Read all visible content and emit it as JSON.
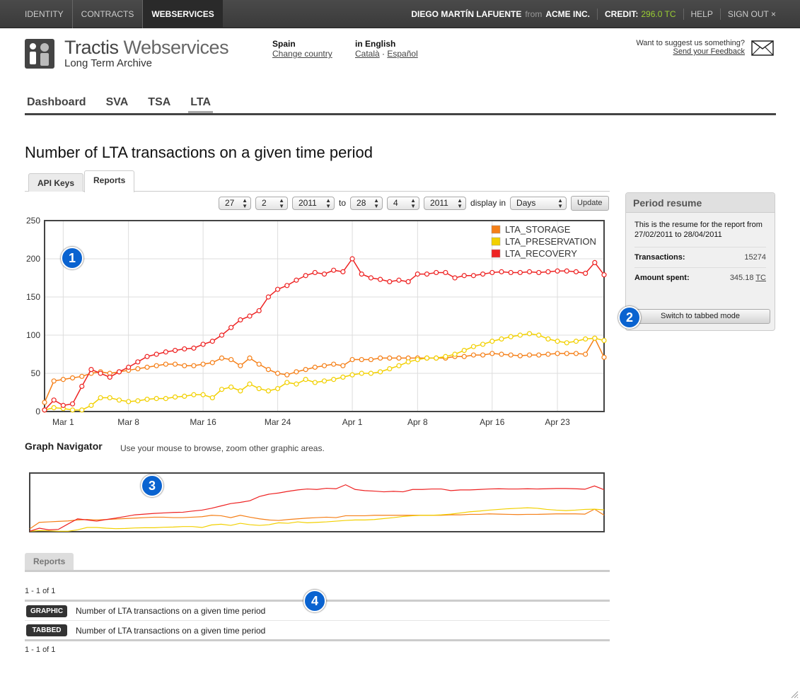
{
  "topbar": {
    "nav": [
      "IDENTITY",
      "CONTRACTS",
      "WEBSERVICES"
    ],
    "active_nav": "WEBSERVICES",
    "user": "DIEGO MARTÍN LAFUENTE",
    "from": "from",
    "company": "ACME INC.",
    "credit_label": "CREDIT:",
    "credit_value": "296.0 TC",
    "help": "HELP",
    "signout": "SIGN OUT ×"
  },
  "header": {
    "brand_strong": "Tractis",
    "brand_light": "Webservices",
    "subtitle": "Long Term Archive",
    "country_label": "Spain",
    "country_link": "Change country",
    "language_label": "in English",
    "language_link1": "Català",
    "language_sep": "·",
    "language_link2": "Español",
    "feedback_text": "Want to suggest us something?",
    "feedback_link": "Send your Feedback"
  },
  "mainnav": [
    "Dashboard",
    "SVA",
    "TSA",
    "LTA"
  ],
  "page_title": "Number of LTA transactions on a given time period",
  "subtabs": [
    "API Keys",
    "Reports"
  ],
  "filter": {
    "from_day": "27",
    "from_month": "2",
    "from_year": "2011",
    "to_label": "to",
    "to_day": "28",
    "to_month": "4",
    "to_year": "2011",
    "display_label": "display in",
    "unit": "Days",
    "update": "Update"
  },
  "panel": {
    "title": "Period resume",
    "description": "This is the resume for the report from 27/02/2011 to 28/04/2011",
    "transactions_label": "Transactions:",
    "transactions_value": "15274",
    "amount_label": "Amount spent:",
    "amount_value": "345.18",
    "amount_unit": "TC",
    "switch_button": "Switch to tabbed mode"
  },
  "graph_navigator": {
    "title": "Graph Navigator",
    "description": "Use your mouse to browse, zoom other graphic areas."
  },
  "badges": [
    "1",
    "2",
    "3",
    "4"
  ],
  "reports": {
    "tab": "Reports",
    "count_top": "1 - 1 of 1",
    "count_bottom": "1 - 1 of 1",
    "rows": [
      {
        "tag": "GRAPHIC",
        "title": "Number of LTA transactions on a given time period"
      },
      {
        "tag": "TABBED",
        "title": "Number of LTA transactions on a given time period"
      }
    ]
  },
  "chart_data": {
    "type": "line",
    "x": [
      "2011-02-27",
      "2011-02-28",
      "2011-03-01",
      "2011-03-02",
      "2011-03-03",
      "2011-03-04",
      "2011-03-05",
      "2011-03-06",
      "2011-03-07",
      "2011-03-08",
      "2011-03-09",
      "2011-03-10",
      "2011-03-11",
      "2011-03-12",
      "2011-03-13",
      "2011-03-14",
      "2011-03-15",
      "2011-03-16",
      "2011-03-17",
      "2011-03-18",
      "2011-03-19",
      "2011-03-20",
      "2011-03-21",
      "2011-03-22",
      "2011-03-23",
      "2011-03-24",
      "2011-03-25",
      "2011-03-26",
      "2011-03-27",
      "2011-03-28",
      "2011-03-29",
      "2011-03-30",
      "2011-03-31",
      "2011-04-01",
      "2011-04-02",
      "2011-04-03",
      "2011-04-04",
      "2011-04-05",
      "2011-04-06",
      "2011-04-07",
      "2011-04-08",
      "2011-04-09",
      "2011-04-10",
      "2011-04-11",
      "2011-04-12",
      "2011-04-13",
      "2011-04-14",
      "2011-04-15",
      "2011-04-16",
      "2011-04-17",
      "2011-04-18",
      "2011-04-19",
      "2011-04-20",
      "2011-04-21",
      "2011-04-22",
      "2011-04-23",
      "2011-04-24",
      "2011-04-25",
      "2011-04-26",
      "2011-04-27",
      "2011-04-28"
    ],
    "x_tick_labels": [
      "Mar 1",
      "Mar 8",
      "Mar 16",
      "Mar 24",
      "Apr 1",
      "Apr 8",
      "Apr 16",
      "Apr 23"
    ],
    "x_tick_dates": [
      "2011-03-01",
      "2011-03-08",
      "2011-03-16",
      "2011-03-24",
      "2011-04-01",
      "2011-04-08",
      "2011-04-16",
      "2011-04-23"
    ],
    "ylim": [
      0,
      250
    ],
    "y_ticks": [
      0,
      50,
      100,
      150,
      200,
      250
    ],
    "grid": true,
    "legend_position": "top-right",
    "series": [
      {
        "name": "LTA_STORAGE",
        "color": "#f57f17",
        "values": [
          12,
          40,
          42,
          44,
          46,
          50,
          52,
          50,
          52,
          54,
          56,
          58,
          60,
          62,
          62,
          60,
          60,
          62,
          64,
          70,
          68,
          60,
          70,
          62,
          55,
          50,
          48,
          52,
          55,
          58,
          60,
          62,
          60,
          68,
          68,
          68,
          70,
          70,
          70,
          70,
          70,
          70,
          70,
          70,
          72,
          72,
          74,
          74,
          76,
          75,
          74,
          73,
          74,
          74,
          75,
          76,
          76,
          76,
          75,
          96,
          71
        ]
      },
      {
        "name": "LTA_PRESERVATION",
        "color": "#f2d000",
        "values": [
          2,
          5,
          4,
          2,
          2,
          8,
          18,
          18,
          15,
          13,
          14,
          16,
          17,
          17,
          19,
          20,
          22,
          22,
          18,
          29,
          32,
          27,
          36,
          30,
          27,
          30,
          38,
          36,
          42,
          38,
          40,
          42,
          45,
          48,
          50,
          50,
          52,
          56,
          60,
          65,
          68,
          70,
          70,
          72,
          75,
          80,
          85,
          88,
          92,
          95,
          98,
          100,
          102,
          100,
          95,
          92,
          90,
          92,
          95,
          96,
          93
        ]
      },
      {
        "name": "LTA_RECOVERY",
        "color": "#ee2222",
        "values": [
          2,
          15,
          8,
          10,
          33,
          55,
          50,
          45,
          52,
          58,
          65,
          72,
          75,
          78,
          80,
          82,
          83,
          88,
          92,
          100,
          110,
          120,
          125,
          132,
          150,
          160,
          165,
          172,
          178,
          182,
          180,
          185,
          183,
          200,
          180,
          175,
          173,
          170,
          172,
          170,
          180,
          180,
          182,
          182,
          175,
          178,
          178,
          180,
          182,
          183,
          182,
          182,
          183,
          182,
          183,
          184,
          184,
          183,
          181,
          195,
          179
        ]
      }
    ]
  }
}
